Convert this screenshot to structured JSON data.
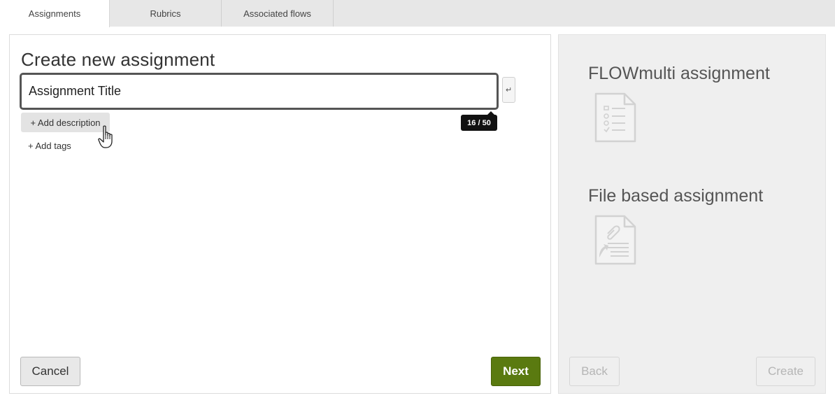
{
  "tabs": [
    {
      "label": "Assignments",
      "active": true
    },
    {
      "label": "Rubrics",
      "active": false
    },
    {
      "label": "Associated flows",
      "active": false
    }
  ],
  "form": {
    "heading": "Create new assignment",
    "title_value": "Assignment Title",
    "enter_symbol": "↵",
    "char_counter": "16 / 50",
    "add_description": "+ Add description",
    "add_tags": "+ Add tags",
    "cancel": "Cancel",
    "next": "Next"
  },
  "types": {
    "flowmulti": {
      "title": "FLOWmulti assignment",
      "icon": "checklist-document-icon"
    },
    "file_based": {
      "title": "File based assignment",
      "icon": "attachment-document-icon"
    },
    "back": "Back",
    "create": "Create"
  },
  "colors": {
    "accent": "#5a7a10",
    "tab_bar": "#e7e7e7",
    "right_panel": "#efefef",
    "disabled_text": "#b5b5b5"
  }
}
